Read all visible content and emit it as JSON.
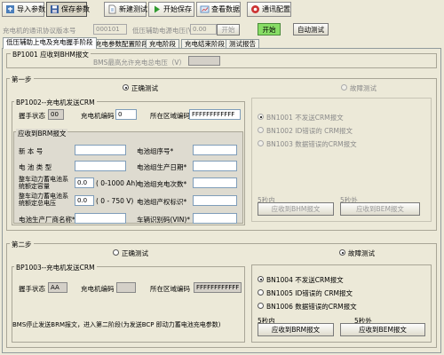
{
  "toolbar": {
    "import": "导入参数",
    "save": "保存参数",
    "new_test": "新建测试",
    "start_save": "开始保存",
    "view_data": "查看数据",
    "comm_config": "通讯配置"
  },
  "header_row": {
    "bms_code_label": "充电机的通讯协议版本号",
    "bms_code_value": "000101",
    "aux_voltage_label": "低压辅助电源电压(V)",
    "aux_voltage_value": "0.00",
    "disabled_btn": "开始",
    "start_btn": "开始",
    "auto_test_btn": "自动测试"
  },
  "tabs": [
    "低压辅助上电及充电握手阶段",
    "充电参数配置阶段",
    "充电阶段",
    "充电结束阶段",
    "测试报告"
  ],
  "bp1001": {
    "title": "BP1001 应收到BHM报文",
    "label": "BMS最高允许充电总电压（V）"
  },
  "step1": {
    "title": "第一步",
    "correct_label": "正确测试",
    "fault_label": "故障测试",
    "bp1002_title": "BP1002--充电机发送CRM",
    "handshake_label": "握手状态",
    "handshake_value": "00",
    "charger_code_label": "充电机编码",
    "charger_code_value": "0",
    "region_code_label": "所在区域编码",
    "region_code_value": "FFFFFFFFFFFF",
    "brm_title": "应收到BRM报文",
    "fields": {
      "version_label": "新 本 号",
      "battery_type_label": "电 池 类 型",
      "rated_capacity_label": "整车动力蓄电池系统额定容量",
      "rated_capacity_value": "0.0",
      "rated_capacity_unit": "( 0-1000 Ah)",
      "rated_voltage_label": "整车动力蓄电池系统额定总电压",
      "rated_voltage_value": "0.0",
      "rated_voltage_unit": "( 0 - 750 V)",
      "manufacturer_label": "电池生产厂商名称*",
      "group_no_label": "电池组序号*",
      "prod_date_label": "电池组生产日期*",
      "cycle_count_label": "电池组充电次数*",
      "ownership_label": "电池组产权标识*",
      "vin_label": "车辆识别码(VIN)*"
    },
    "fault_opts": [
      "BN1001 不发送CRM报文",
      "BN1002 ID错误的 CRM报文",
      "BN1003 数据错误的CRM报文"
    ],
    "within_label": "5秒内",
    "after_label": "5秒外",
    "within_btn": "应收到BHM报文",
    "after_btn": "应收到BEM报文"
  },
  "step2": {
    "title": "第二步",
    "correct_label": "正确测试",
    "fault_label": "故障测试",
    "bp1003_title": "BP1003--充电机发送CRM",
    "handshake_label": "握手状态",
    "handshake_value": "AA",
    "charger_code_label": "充电机编码",
    "region_code_label": "所在区域编码",
    "region_code_value": "FFFFFFFFFFFF",
    "note": "BMS停止发送BRM报文，进入第二阶段(为发送BCP 即动力蓄电池充电参数)",
    "fault_opts": [
      "BN1004 不发送CRM报文",
      "BN1005 ID错误的 CRM报文",
      "BN1006 数据错误的CRM报文"
    ],
    "selected_fault": 0,
    "within_label": "5秒内",
    "after_label": "5秒外",
    "within_btn": "应收到BRM报文",
    "after_btn": "应收到BEM报文"
  },
  "colors": {
    "background": "#ece9d8",
    "start_button": "#88dd66",
    "group_border": "#a9a697"
  }
}
